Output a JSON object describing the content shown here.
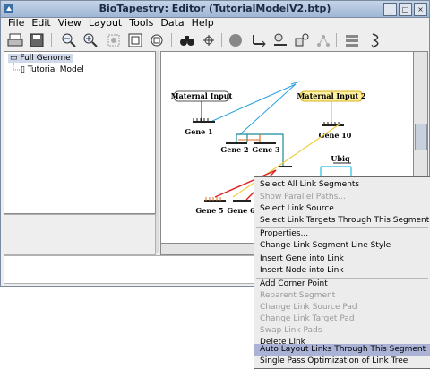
{
  "window": {
    "title": "BioTapestry: Editor (TutorialModelV2.btp)"
  },
  "menubar": {
    "items": [
      "File",
      "Edit",
      "View",
      "Layout",
      "Tools",
      "Data",
      "Help"
    ]
  },
  "toolbar": {
    "icons": [
      "print-icon",
      "save-icon",
      "zoom-out-icon",
      "zoom-in-icon",
      "zoom-selected-icon",
      "zoom-to-model-icon",
      "zoom-to-current-icon",
      "binoculars-icon",
      "crosshair-icon",
      "add-gene-icon",
      "add-link-icon",
      "add-node-icon",
      "add-region-icon",
      "propagate-icon",
      "layout-icon",
      "squiggle-icon"
    ]
  },
  "tree": {
    "root": "Full Genome",
    "child": "Tutorial Model"
  },
  "network": {
    "nodes": {
      "maternal1": "Maternal Input",
      "maternal2": "Maternal Input 2",
      "gene1": "Gene 1",
      "gene2": "Gene 2",
      "gene3": "Gene 3",
      "gene10": "Gene 10",
      "ubiq": "Ubiq",
      "gene5": "Gene 5",
      "gene6": "Gene 6"
    },
    "colors": {
      "blue_link": "#2aa0e0",
      "teal_link": "#1a8a9a",
      "orange_link": "#e07020",
      "yellow_link": "#f0d040",
      "red_link": "#e02020",
      "cyan_link": "#20c0e0",
      "maternal2_highlight": "#fff0a0"
    }
  },
  "context_menu": {
    "items": [
      {
        "label": "Select All Link Segments",
        "enabled": true
      },
      {
        "label": "Show Parallel Paths...",
        "enabled": false
      },
      {
        "label": "Select Link Source",
        "enabled": true
      },
      {
        "label": "Select Link Targets Through This Segment",
        "enabled": true
      },
      {
        "label": "Properties...",
        "enabled": true
      },
      {
        "label": "Change Link Segment Line Style",
        "enabled": true
      },
      {
        "label": "Insert Gene into Link",
        "enabled": true
      },
      {
        "label": "Insert Node into Link",
        "enabled": true
      },
      {
        "label": "Add Corner Point",
        "enabled": true
      },
      {
        "label": "Reparent Segment",
        "enabled": false
      },
      {
        "label": "Change Link Source Pad",
        "enabled": false
      },
      {
        "label": "Change Link Target Pad",
        "enabled": false
      },
      {
        "label": "Swap Link Pads",
        "enabled": false
      },
      {
        "label": "Delete Link",
        "enabled": true
      },
      {
        "label": "Auto Layout Links Through This Segment",
        "enabled": true,
        "highlighted": true
      },
      {
        "label": "Single Pass Optimization of Link Tree",
        "enabled": true
      }
    ]
  }
}
